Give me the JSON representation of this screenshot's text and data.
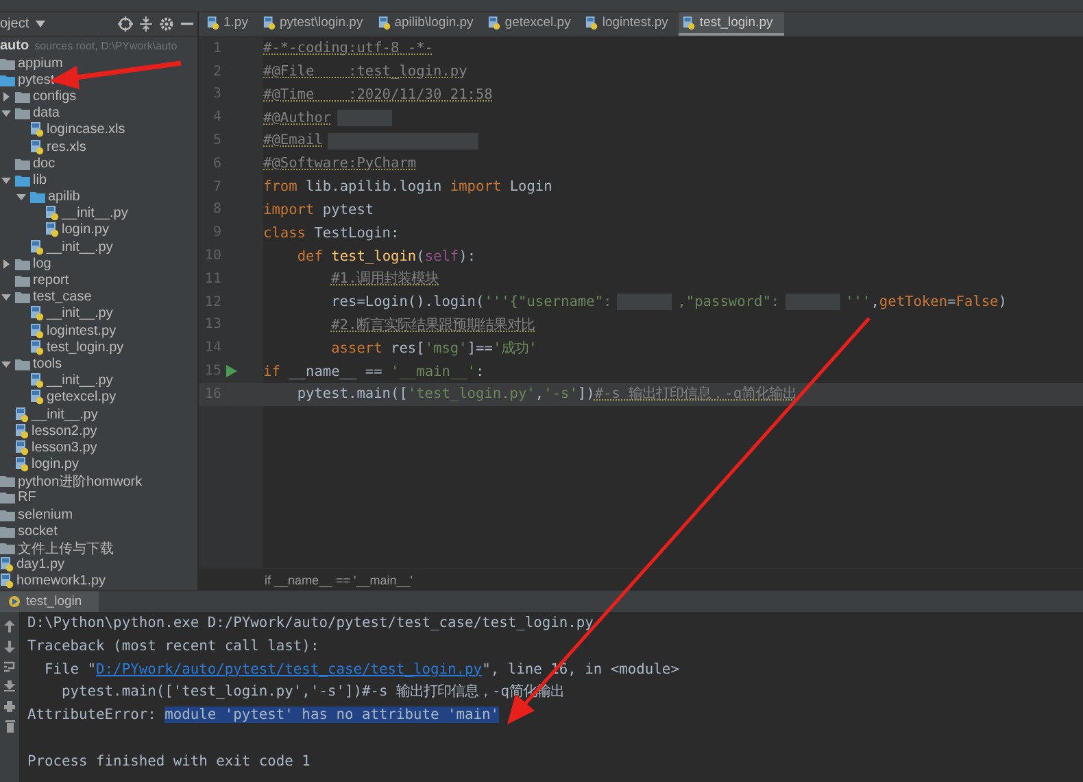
{
  "project_panel": {
    "title": "oject"
  },
  "tree": [
    {
      "name": "auto",
      "kind": "root",
      "hint": "sources root, D:\\PYwork\\auto",
      "children": [
        {
          "name": "appium",
          "kind": "folder"
        },
        {
          "name": "pytest",
          "kind": "package",
          "children": [
            {
              "name": "configs",
              "kind": "folder",
              "expanded": false
            },
            {
              "name": "data",
              "kind": "folder",
              "expanded": true,
              "children": [
                {
                  "name": "logincase.xls",
                  "kind": "file"
                },
                {
                  "name": "res.xls",
                  "kind": "file"
                }
              ]
            },
            {
              "name": "doc",
              "kind": "folder"
            },
            {
              "name": "lib",
              "kind": "package",
              "expanded": true,
              "children": [
                {
                  "name": "apilib",
                  "kind": "package",
                  "expanded": true,
                  "children": [
                    {
                      "name": "__init__.py",
                      "kind": "file"
                    },
                    {
                      "name": "login.py",
                      "kind": "file"
                    }
                  ]
                },
                {
                  "name": "__init__.py",
                  "kind": "file"
                }
              ]
            },
            {
              "name": "log",
              "kind": "folder",
              "expanded": false
            },
            {
              "name": "report",
              "kind": "folder"
            },
            {
              "name": "test_case",
              "kind": "folder",
              "expanded": true,
              "children": [
                {
                  "name": "__init__.py",
                  "kind": "file"
                },
                {
                  "name": "logintest.py",
                  "kind": "file"
                },
                {
                  "name": "test_login.py",
                  "kind": "file"
                }
              ]
            },
            {
              "name": "tools",
              "kind": "folder",
              "expanded": true,
              "children": [
                {
                  "name": "__init__.py",
                  "kind": "file"
                },
                {
                  "name": "getexcel.py",
                  "kind": "file"
                }
              ]
            },
            {
              "name": "__init__.py",
              "kind": "file"
            },
            {
              "name": "lesson2.py",
              "kind": "file"
            },
            {
              "name": "lesson3.py",
              "kind": "file"
            },
            {
              "name": "login.py",
              "kind": "file"
            }
          ]
        },
        {
          "name": "python进阶homwork",
          "kind": "folder"
        },
        {
          "name": "RF",
          "kind": "folder"
        },
        {
          "name": "selenium",
          "kind": "folder"
        },
        {
          "name": "socket",
          "kind": "folder"
        },
        {
          "name": "文件上传与下载",
          "kind": "folder"
        },
        {
          "name": "day1.py",
          "kind": "file"
        },
        {
          "name": "homework1.py",
          "kind": "file"
        }
      ]
    }
  ],
  "tabs": [
    {
      "label": "1.py",
      "selected": false
    },
    {
      "label": "pytest\\login.py",
      "selected": false
    },
    {
      "label": "apilib\\login.py",
      "selected": false
    },
    {
      "label": "getexcel.py",
      "selected": false
    },
    {
      "label": "logintest.py",
      "selected": false
    },
    {
      "label": "test_login.py",
      "selected": true
    }
  ],
  "code_lines": [
    {
      "number": "1",
      "current": false,
      "segments": [
        {
          "kind": "comment",
          "text": "#-*-coding:utf-8 -*-"
        }
      ]
    },
    {
      "number": "2",
      "current": false,
      "segments": [
        {
          "kind": "comment",
          "text": "#@File    :test_login.py"
        }
      ]
    },
    {
      "number": "3",
      "current": false,
      "segments": [
        {
          "kind": "comment",
          "text": "#@Time    :2020/11/30 21:58"
        }
      ]
    },
    {
      "number": "4",
      "current": false,
      "segments": [
        {
          "kind": "comment",
          "text": "#@Author"
        },
        {
          "kind": "redacted_short"
        }
      ]
    },
    {
      "number": "5",
      "current": false,
      "segments": [
        {
          "kind": "comment",
          "text": "#@Email"
        },
        {
          "kind": "redacted_long"
        }
      ]
    },
    {
      "number": "6",
      "current": false,
      "segments": [
        {
          "kind": "comment",
          "text": "#@Software:PyCharm"
        }
      ]
    },
    {
      "number": "7",
      "current": false,
      "segments": [
        {
          "kind": "keyword",
          "text": "from"
        },
        {
          "kind": "plain",
          "text": " lib.apilib.login "
        },
        {
          "kind": "keyword",
          "text": "import"
        },
        {
          "kind": "plain",
          "text": " Login"
        }
      ]
    },
    {
      "number": "8",
      "current": false,
      "segments": [
        {
          "kind": "keyword",
          "text": "import"
        },
        {
          "kind": "plain",
          "text": " pytest"
        }
      ]
    },
    {
      "number": "9",
      "current": false,
      "segments": [
        {
          "kind": "keyword",
          "text": "class"
        },
        {
          "kind": "plain",
          "text": " TestLogin:"
        }
      ]
    },
    {
      "number": "10",
      "current": false,
      "segments": [
        {
          "kind": "keyword",
          "text": "    def "
        },
        {
          "kind": "function",
          "text": "test_login"
        },
        {
          "kind": "plain",
          "text": "("
        },
        {
          "kind": "self",
          "text": "self"
        },
        {
          "kind": "plain",
          "text": "):"
        }
      ]
    },
    {
      "number": "11",
      "current": false,
      "segments": [
        {
          "kind": "comment",
          "text": "        #1.调用封装模块"
        }
      ]
    },
    {
      "number": "12",
      "current": false,
      "segments": [
        {
          "kind": "plain",
          "text": "        res=Login().login("
        },
        {
          "kind": "string",
          "text": "'''{\"username\":"
        },
        {
          "kind": "redacted_short"
        },
        {
          "kind": "string",
          "text": ",\"password\":"
        },
        {
          "kind": "redacted_short"
        },
        {
          "kind": "string",
          "text": "'''"
        },
        {
          "kind": "plain",
          "text": ","
        },
        {
          "kind": "keyword",
          "text": "getToken"
        },
        {
          "kind": "plain",
          "text": "="
        },
        {
          "kind": "keyword",
          "text": "False"
        },
        {
          "kind": "plain",
          "text": ")"
        }
      ]
    },
    {
      "number": "13",
      "current": false,
      "segments": [
        {
          "kind": "comment",
          "text": "        #2.断言实际结果跟预期结果对比"
        }
      ]
    },
    {
      "number": "14",
      "current": false,
      "segments": [
        {
          "kind": "keyword",
          "text": "        assert"
        },
        {
          "kind": "plain",
          "text": " res["
        },
        {
          "kind": "string",
          "text": "'msg'"
        },
        {
          "kind": "plain",
          "text": "]=="
        },
        {
          "kind": "string",
          "text": "'成功'"
        }
      ]
    },
    {
      "number": "15",
      "current": false,
      "kind": "runnable",
      "segments": [
        {
          "kind": "keyword",
          "text": "if"
        },
        {
          "kind": "plain",
          "text": " __name__ == "
        },
        {
          "kind": "string",
          "text": "'__main__'"
        },
        {
          "kind": "plain",
          "text": ":"
        }
      ]
    },
    {
      "number": "16",
      "current": true,
      "segments": [
        {
          "kind": "plain",
          "text": "    pytest.main(["
        },
        {
          "kind": "string",
          "text": "'test_login.py'"
        },
        {
          "kind": "plain",
          "text": ","
        },
        {
          "kind": "string",
          "text": "'-s'"
        },
        {
          "kind": "plain",
          "text": "])"
        },
        {
          "kind": "comment",
          "text": "#-s 输出打印信息，-q简化输出"
        }
      ]
    }
  ],
  "breadcrumb": "if __name__ == '__main__'",
  "run_tab": {
    "label": "test_login"
  },
  "console_lines": [
    {
      "kind": "command",
      "segments": [
        {
          "kind": "plain",
          "text": "D:\\Python\\python.exe D:/PYwork/auto/pytest/test_case/test_login.py"
        }
      ]
    },
    {
      "kind": "error",
      "segments": [
        {
          "kind": "plain",
          "text": "Traceback (most recent call last):"
        }
      ]
    },
    {
      "kind": "error",
      "segments": [
        {
          "kind": "plain",
          "text": "  File \""
        },
        {
          "kind": "link",
          "text": "D:/PYwork/auto/pytest/test_case/test_login.py"
        },
        {
          "kind": "plain",
          "text": "\", line 16, in <module>"
        }
      ]
    },
    {
      "kind": "error",
      "segments": [
        {
          "kind": "plain",
          "text": "    pytest.main(['test_login.py','-s'])#-s 输出打印信息，-q简化输出"
        }
      ]
    },
    {
      "kind": "error",
      "segments": [
        {
          "kind": "plain",
          "text": "AttributeError: "
        },
        {
          "kind": "selected",
          "text": "module 'pytest' has no attribute 'main'"
        }
      ]
    },
    {
      "kind": "status",
      "segments": [
        {
          "kind": "plain",
          "text": "Process finished with exit code 1"
        }
      ]
    }
  ]
}
